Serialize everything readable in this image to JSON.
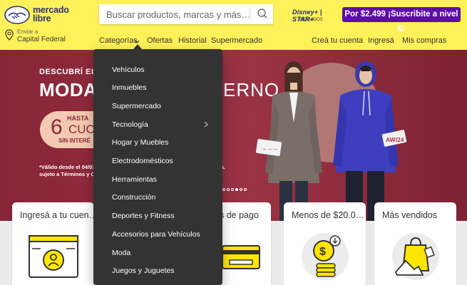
{
  "brand": {
    "line1": "mercado",
    "line2": "libre"
  },
  "search": {
    "placeholder": "Buscar productos, marcas y más…",
    "icon": "search-icon"
  },
  "disney": {
    "logo_text": "Disney+ | STAR+",
    "sub": "INCLUIDOS"
  },
  "promo": {
    "label": "Por $2.499 ¡Suscribite a nivel 6!",
    "color": "#5e0ca8"
  },
  "location": {
    "label": "Enviar a",
    "value": "Capital Federal",
    "icon": "location-pin-icon"
  },
  "nav": {
    "categories": "Categorías",
    "offers": "Ofertas",
    "history": "Historial",
    "supermarket": "Supermercado",
    "create_account": "Creá tu cuenta",
    "login": "Ingresá",
    "purchases": "Mis compras"
  },
  "hero": {
    "line1": "DESCUBRÍ EL A",
    "line2": "MODA",
    "line3": "ERNO",
    "badge_hasta": "HASTA",
    "badge_number": "6",
    "badge_cuotas": "CUOTAS",
    "badge_sin": "SIN INTERÉ",
    "legal_line1": "*Válido desde el 04/03",
    "legal_line2": "sujeto a Términos y Co",
    "legal_right": "da.",
    "tag_left": "→→→",
    "tag_right": "AW/24",
    "bg_color": "#8a2a3a",
    "dots_total": 6,
    "dot_active": 4
  },
  "dropdown": {
    "items": [
      "Vehículos",
      "Inmuebles",
      "Supermercado",
      "Tecnología",
      "Hogar y Muebles",
      "Electrodomésticos",
      "Herramientas",
      "Construcción",
      "Deportes y Fitness",
      "Accesorios para Vehículos",
      "Moda",
      "Juegos y Juguetes"
    ],
    "submenu_item": "Tecnología",
    "bg_color": "#333333"
  },
  "cards": [
    {
      "title": "Ingresá a tu cuen…",
      "icon": "user-account-icon"
    },
    {
      "title": "s de pago",
      "icon": "payment-card-icon"
    },
    {
      "title": "Menos de $20.0…",
      "icon": "dollar-coin-icon"
    },
    {
      "title": "Más vendidos",
      "icon": "shopping-bag-icon"
    }
  ],
  "colors": {
    "header": "#fff159",
    "brand_blue": "#2d3277",
    "accent_blue": "#3483fa"
  }
}
